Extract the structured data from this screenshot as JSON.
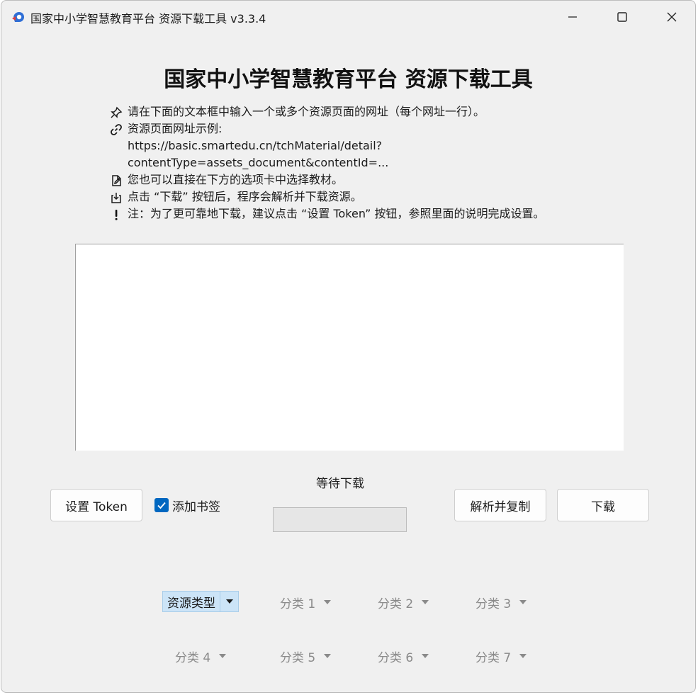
{
  "window": {
    "title": "国家中小学智慧教育平台 资源下载工具 v3.3.4",
    "controls": [
      "minimize-icon",
      "maximize-icon",
      "close-icon"
    ]
  },
  "heading": "国家中小学智慧教育平台 资源下载工具",
  "instructions": [
    {
      "icon": "pin-icon",
      "text": "请在下面的文本框中输入一个或多个资源页面的网址（每个网址一行）。"
    },
    {
      "icon": "link-icon",
      "text": "资源页面网址示例:"
    },
    {
      "icon": "",
      "text": "https://basic.smartedu.cn/tchMaterial/detail?"
    },
    {
      "icon": "",
      "text": "contentType=assets_document&contentId=..."
    },
    {
      "icon": "edit-document-icon",
      "text": "您也可以直接在下方的选项卡中选择教材。"
    },
    {
      "icon": "download-box-icon",
      "text": "点击 “下载” 按钮后，程序会解析并下载资源。"
    },
    {
      "icon": "exclamation-icon",
      "text": "注：为了更可靠地下载，建议点击 “设置 Token” 按钮，参照里面的说明完成设置。"
    }
  ],
  "url_input": {
    "value": "",
    "placeholder": ""
  },
  "controls": {
    "set_token_label": "设置 Token",
    "bookmark_label": "添加书签",
    "bookmark_checked": true,
    "status_text": "等待下载",
    "progress": 0,
    "parse_copy_label": "解析并复制",
    "download_label": "下载"
  },
  "filters": {
    "row1": [
      {
        "label": "资源类型",
        "active": true
      },
      {
        "label": "分类 1",
        "active": false
      },
      {
        "label": "分类 2",
        "active": false
      },
      {
        "label": "分类 3",
        "active": false
      }
    ],
    "row2": [
      {
        "label": "分类 4",
        "active": false
      },
      {
        "label": "分类 5",
        "active": false
      },
      {
        "label": "分类 6",
        "active": false
      },
      {
        "label": "分类 7",
        "active": false
      }
    ]
  },
  "colors": {
    "accent": "#0067c0",
    "window_bg": "#f0f0f0",
    "active_dropdown_bg": "#cce4f7",
    "disabled_text": "#8a8a8a"
  }
}
